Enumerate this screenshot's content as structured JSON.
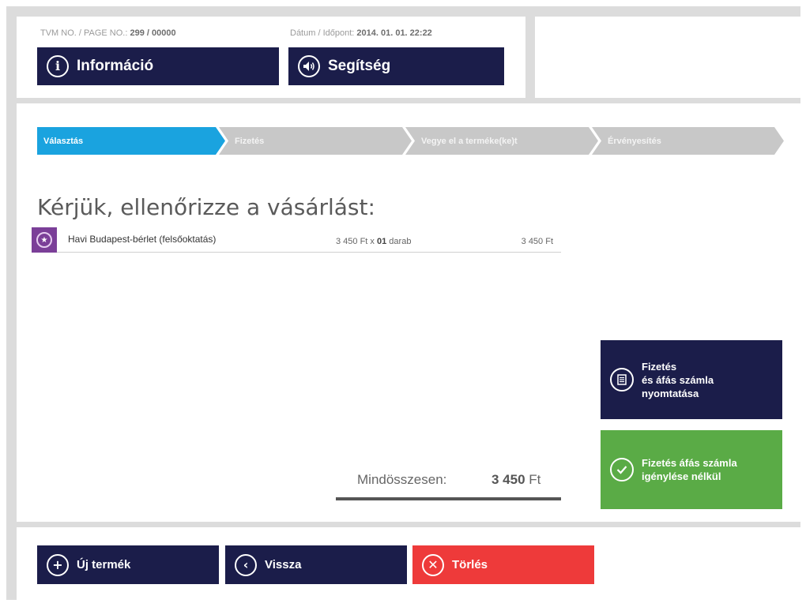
{
  "header": {
    "tvm_label": "TVM NO. / PAGE NO.:",
    "tvm_value": "299 / 00000",
    "datetime_label": "Dátum / Időpont:",
    "datetime_value": "2014. 01. 01. 22:22",
    "info_button": "Információ",
    "help_button": "Segítség"
  },
  "steps": [
    "Választás",
    "Fizetés",
    "Vegye el a terméke(ke)t",
    "Érvényesítés"
  ],
  "main": {
    "heading": "Kérjük, ellenőrizze a vásárlást:",
    "item": {
      "name": "Havi Budapest-bérlet (felsőoktatás)",
      "unit_price": "3 450 Ft x",
      "quantity": "01",
      "unit": "darab",
      "total": "3 450 Ft"
    },
    "total_label": "Mindösszesen:",
    "total_amount": "3 450",
    "total_currency": "Ft"
  },
  "side_buttons": {
    "pay_with_invoice": "Fizetés\nés áfás számla\nnyomtatása",
    "pay_without_invoice": "Fizetés áfás számla\nigénylése nélkül"
  },
  "footer": {
    "new_product": "Új termék",
    "back": "Vissza",
    "delete": "Törlés"
  },
  "colors": {
    "navy": "#1b1d4a",
    "active_step": "#1aa3df",
    "inactive_step": "#c8c8c8",
    "green": "#5aab46",
    "red": "#ee3a3a",
    "purple": "#7b3f98"
  },
  "icons": {
    "info": "info-icon",
    "help": "speaker-icon",
    "receipt": "receipt-icon",
    "check": "check-circle-icon",
    "plus": "plus-circle-icon",
    "back": "chevron-left-icon",
    "delete": "close-circle-icon"
  }
}
